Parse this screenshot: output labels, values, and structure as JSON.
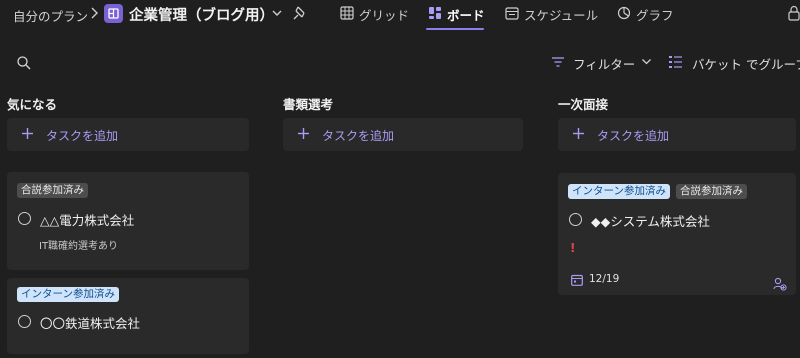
{
  "header": {
    "breadcrumb": "自分のプラン",
    "plan_title": "企業管理（ブログ用）",
    "tabs": [
      {
        "label": "グリッド",
        "icon": "grid-icon"
      },
      {
        "label": "ボード",
        "icon": "board-icon",
        "active": true
      },
      {
        "label": "スケジュール",
        "icon": "schedule-icon"
      },
      {
        "label": "グラフ",
        "icon": "chart-icon"
      }
    ]
  },
  "toolbar": {
    "filter_label": "フィルター",
    "bucket_label": "バケット でグループ"
  },
  "colors": {
    "accent": "#8b7ff0",
    "plan_icon": "#7b61d6",
    "tag_blue_bg": "#cfe4fa",
    "tag_gray_bg": "#4d4d4d",
    "priority": "#e0444f"
  },
  "columns": [
    {
      "title": "気になる",
      "add_task_label": "タスクを追加",
      "cards": [
        {
          "tags": [
            "合説参加済み"
          ],
          "title": "△△電力株式会社",
          "note": "IT職確約選考あり"
        },
        {
          "tags": [
            "インターン参加済み"
          ],
          "title": "〇〇鉄道株式会社"
        }
      ]
    },
    {
      "title": "書類選考",
      "add_task_label": "タスクを追加",
      "cards": []
    },
    {
      "title": "一次面接",
      "add_task_label": "タスクを追加",
      "cards": [
        {
          "tags": [
            "インターン参加済み",
            "合説参加済み"
          ],
          "title": "◆◆システム株式会社",
          "priority": "!",
          "due": "12/19"
        }
      ]
    }
  ]
}
